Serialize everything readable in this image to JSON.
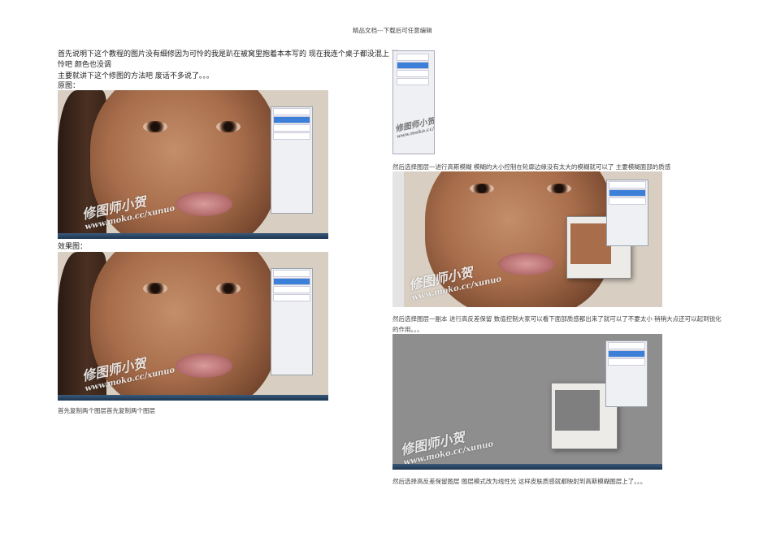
{
  "header": "精品文档---下载后可任意编辑",
  "left": {
    "intro_line1": "首先说明下这个教程的图片没有细修因为可怜的我是趴在被窝里抱着本本写的  现在我连个桌子都没混上  可",
    "intro_line2": "怜吧  颜色也没调",
    "intro_line3": "主要就讲下这个修图的方法吧  废话不多说了。。。",
    "original_label": "原图：",
    "result_label": "效果图：",
    "caption": "首先复制两个图层首先复制两个图层"
  },
  "right": {
    "caption1": "然后选择图层一进行高斯模糊  模糊的大小控制在轮廓边缘没有太大的模糊就可以了  主要模糊面部的质感",
    "caption2_line1": "然后选择图层一副本  进行高反差保留  数值控制大家可以看下面部质感都出来了就可以了不要太小  稍稍大点还可以起到锐化",
    "caption2_line2": "的作用。。。",
    "caption3": "然后选择高反差保留图层  图层模式改为线性光  这样皮肤质感就都映射到高斯模糊图层上了。。。"
  },
  "watermark": {
    "name": "修图师小贺",
    "url": "www.moko.cc/xunuo"
  }
}
